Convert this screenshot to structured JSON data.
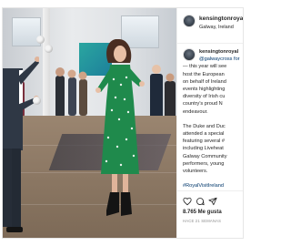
{
  "post": {
    "username": "kensingtonroyal",
    "location": "Galway, Ireland",
    "caption": {
      "author": "kensingtonroyal",
      "mention": "@galwaycross for",
      "lines1": [
        "— this year will see",
        "host the European",
        "on behalf of Ireland",
        "events highlighting",
        "diversity of Irish cu",
        "country's proud N",
        "endeavour."
      ],
      "lines2": [
        "The Duke and Duc",
        "attended a special",
        "featuring several #",
        "including Liveheat",
        "Galway Community",
        "performers, young",
        "volunteers."
      ],
      "hashtag": "#RoyalVisitIreland"
    },
    "likes": "8.765 Me gusta",
    "date": "HACE 21 SEMANAS"
  },
  "icons": {
    "like": "heart-icon",
    "comment": "comment-icon",
    "share": "share-icon"
  },
  "colors": {
    "text": "#262626",
    "link": "#00376b",
    "muted": "#8e8e8e",
    "dress": "#1f8a4c"
  }
}
